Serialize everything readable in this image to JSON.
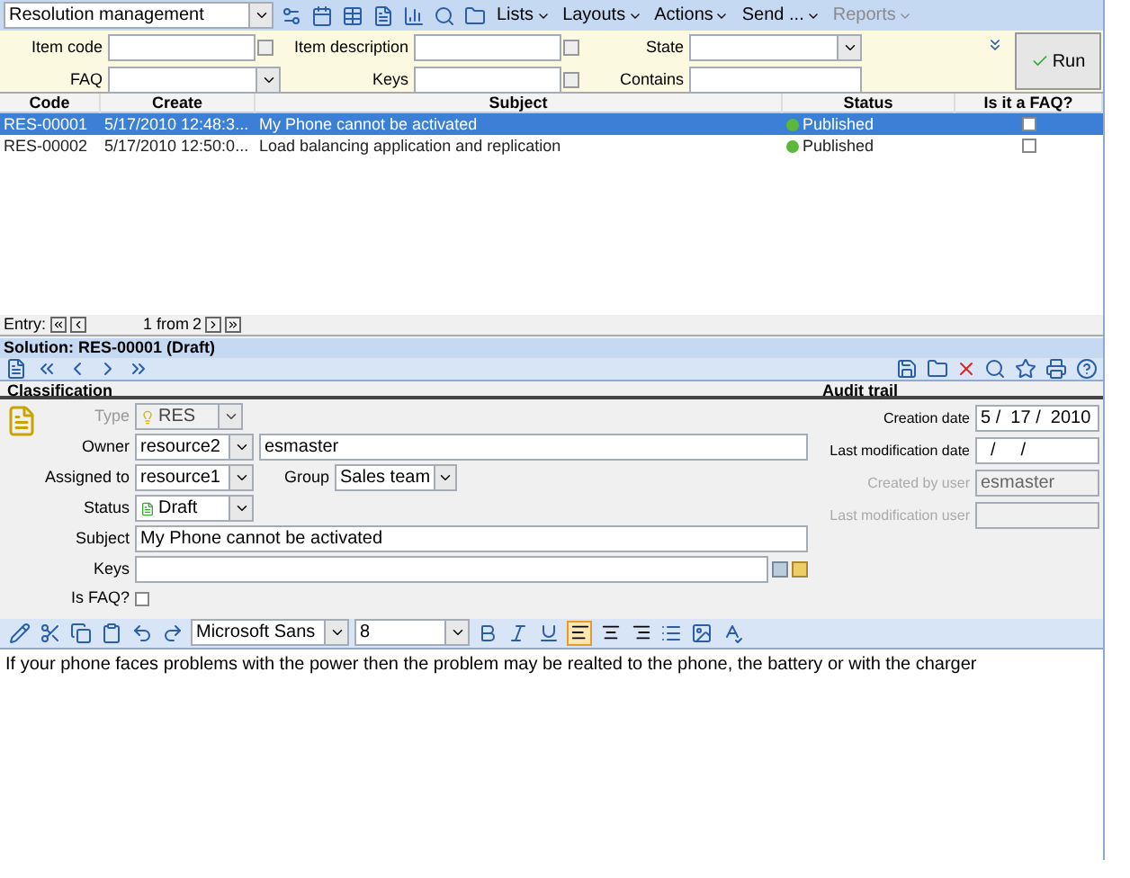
{
  "toolbar": {
    "module": "Resolution management",
    "menus": [
      {
        "label": "Lists",
        "disabled": false
      },
      {
        "label": "Layouts",
        "disabled": false
      },
      {
        "label": "Actions",
        "disabled": false
      },
      {
        "label": "Send ...",
        "disabled": false
      },
      {
        "label": "Reports",
        "disabled": true
      }
    ]
  },
  "filters": [
    {
      "label": "Item code",
      "kind": "browse"
    },
    {
      "label": "Item description",
      "kind": "browse"
    },
    {
      "label": "State",
      "kind": "select"
    },
    {
      "label": "FAQ",
      "kind": "select"
    },
    {
      "label": "Keys",
      "kind": "browse"
    },
    {
      "label": "Contains",
      "kind": "text"
    }
  ],
  "run_button": "Run",
  "table": {
    "columns": [
      "Code",
      "Create",
      "Subject",
      "Status",
      "Is it a FAQ?"
    ],
    "rows": [
      {
        "code": "RES-00001",
        "create": "5/17/2010 12:48:3...",
        "subject": "My Phone cannot be activated",
        "status": "Published",
        "faq": false,
        "selected": true
      },
      {
        "code": "RES-00002",
        "create": "5/17/2010 12:50:0...",
        "subject": "Load balancing application and replication",
        "status": "Published",
        "faq": false,
        "selected": false
      }
    ]
  },
  "pager": {
    "label": "Entry:",
    "position": "1 from",
    "total": "2"
  },
  "solution_title": "Solution: RES-00001 (Draft)",
  "classification": {
    "title": "Classification",
    "type": {
      "label": "Type",
      "value": "RES"
    },
    "owner": {
      "label": "Owner",
      "value": "resource2",
      "name": "esmaster"
    },
    "assigned": {
      "label": "Assigned to",
      "value": "resource1"
    },
    "group": {
      "label": "Group",
      "value": "Sales team"
    },
    "status": {
      "label": "Status",
      "value": "Draft"
    },
    "subject": {
      "label": "Subject",
      "value": "My Phone cannot be activated"
    },
    "keys": {
      "label": "Keys"
    },
    "faq": {
      "label": "Is FAQ?",
      "checked": false
    }
  },
  "audit": {
    "title": "Audit trail",
    "fields": [
      {
        "label": "Creation date",
        "value": "5 /  17 /  2010",
        "disabled": false
      },
      {
        "label": "Last modification date",
        "value": "  /     /",
        "disabled": false
      },
      {
        "label": "Created by user",
        "value": "esmaster",
        "disabled": true
      },
      {
        "label": "Last modification user",
        "disabled": true
      }
    ]
  },
  "editor": {
    "font": "Microsoft Sans",
    "size": "8",
    "align": [
      {
        "kind": "left",
        "selected": true
      },
      {
        "kind": "center",
        "selected": false
      },
      {
        "kind": "right",
        "selected": false
      }
    ],
    "text": "If your phone faces problems with the power then the problem may be realted to the phone, the battery or with the charger"
  }
}
